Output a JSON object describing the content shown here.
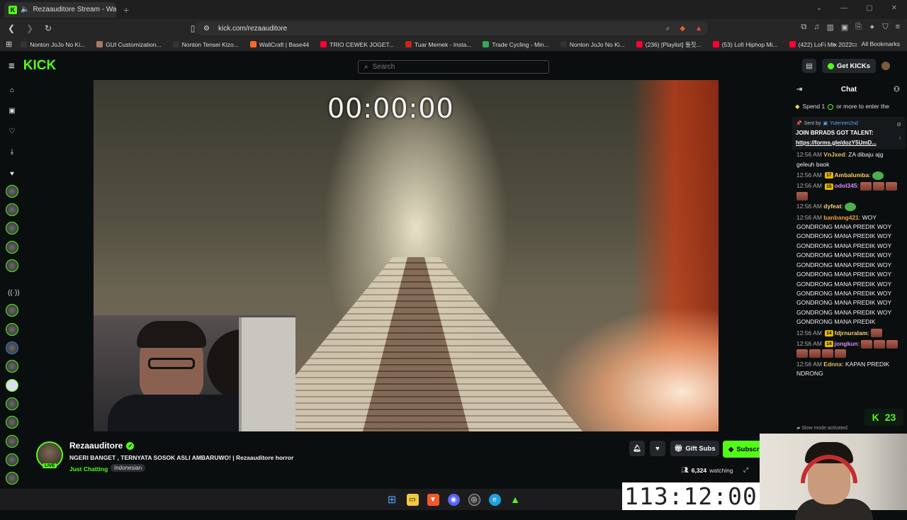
{
  "browser": {
    "tab_title": "Rezaauditore Stream - Watch",
    "tab_close": "✕",
    "new_tab": "+",
    "url": "kick.com/rezaauditore",
    "bookmarks": [
      "Nonton JoJo No Ki...",
      "GUI Customization...",
      "Nonton Tensei Kizo...",
      "WallCraft | Base44",
      "TRIO CEWEK JOGET...",
      "Tuar Memek - Insta...",
      "Trade Cycling - Min...",
      "Nonton JoJo No Ki...",
      "(236) [Playlist] 둘짓...",
      "(53) Lofi Hiphop Mi...",
      "(422) LoFi Mix 2022..."
    ],
    "all_bookmarks": "All Bookmarks",
    "more": "»"
  },
  "header": {
    "logo": "KICK",
    "search_placeholder": "Search",
    "get_kicks": "Get KICKs"
  },
  "video": {
    "overlay_timer": "00:00:00"
  },
  "chat": {
    "title": "Chat",
    "spend_notice": "Spend 1",
    "spend_notice_tail": "or more to enter the",
    "pinned": {
      "sent_by": "Sent by",
      "sender": "Yutenren2nd",
      "text": "JOIN BRRADS GOT TALENT:",
      "link": "https://forms.gle/dozY5UmD..."
    },
    "messages": [
      {
        "time": "12:56 AM",
        "badge": "",
        "user": "VnJxed",
        "color": "#e0c060",
        "text": "ZA dibaju ajg geleuh baok",
        "emotes": 0
      },
      {
        "time": "12:56 AM",
        "badge": "17",
        "user": "Ambalumba",
        "color": "#f4d35e",
        "text": "",
        "emotes": 0,
        "green": true
      },
      {
        "time": "12:56 AM",
        "badge": "15",
        "user": "odol345",
        "color": "#d58bf7",
        "text": "",
        "emotes": 4
      },
      {
        "time": "12:56 AM",
        "badge": "",
        "user": "dyfeat",
        "color": "#f3d26a",
        "text": "",
        "emotes": 0,
        "green": true
      },
      {
        "time": "12:56 AM",
        "badge": "",
        "user": "banbang421",
        "color": "#f0a040",
        "text": "WOY GONDRONG MANA PREDIK WOY GONDRONG MANA PREDIK WOY GONDRONG MANA PREDIK WOY GONDRONG MANA PREDIK WOY GONDRONG MANA PREDIK WOY GONDRONG MANA PREDIK WOY GONDRONG MANA PREDIK WOY GONDRONG MANA PREDIK WOY GONDRONG MANA PREDIK WOY GONDRONG MANA PREDIK WOY GONDRONG MANA PREDIK",
        "emotes": 0
      },
      {
        "time": "12:56 AM",
        "badge": "14",
        "user": "fdjrnuralam",
        "color": "#f3d26a",
        "text": "",
        "emotes": 1
      },
      {
        "time": "12:56 AM",
        "badge": "14",
        "user": "jongkun",
        "color": "#d58bf7",
        "text": "",
        "emotes": 7
      },
      {
        "time": "12:56 AM",
        "badge": "",
        "user": "Ednnx",
        "color": "#e0c060",
        "text": "KAPAN PREDIK NDRONG",
        "emotes": 0
      }
    ],
    "slow_mode": "Slow mode activated",
    "kick_count": "23"
  },
  "stream": {
    "streamer": "Rezaauditore",
    "live": "LIVE",
    "title": "NGERI BANGET , TERNYATA SOSOK ASLI AMBARUWO! | Rezaauditore horror",
    "category": "Just Chatting",
    "tag": "Indonesian",
    "gift_subs": "Gift Subs",
    "subscribe": "Subscri",
    "watching_count": "6,324",
    "watching_label": "watching"
  },
  "overlay": {
    "big_timer": "113:12:00"
  }
}
